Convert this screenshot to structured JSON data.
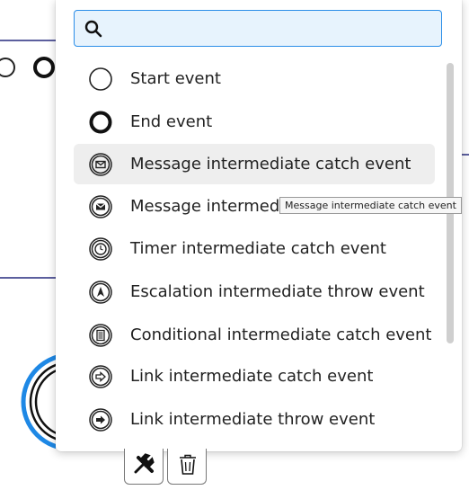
{
  "search": {
    "value": "",
    "placeholder": ""
  },
  "tooltip": "Message intermediate catch event",
  "entries": [
    {
      "label": "Start event",
      "icon": "start-event-icon"
    },
    {
      "label": "End event",
      "icon": "end-event-icon"
    },
    {
      "label": "Message intermediate catch event",
      "icon": "message-catch-icon",
      "hover": true
    },
    {
      "label": "Message intermediate throw event",
      "icon": "message-throw-icon"
    },
    {
      "label": "Timer intermediate catch event",
      "icon": "timer-catch-icon"
    },
    {
      "label": "Escalation intermediate throw event",
      "icon": "escalation-throw-icon"
    },
    {
      "label": "Conditional intermediate catch event",
      "icon": "conditional-catch-icon"
    },
    {
      "label": "Link intermediate catch event",
      "icon": "link-catch-icon"
    },
    {
      "label": "Link intermediate throw event",
      "icon": "link-throw-icon"
    }
  ],
  "toolbar": {
    "buttons": [
      "wrench-icon",
      "trash-icon"
    ]
  },
  "colors": {
    "selection": "#1e88e5",
    "search_bg": "#e7f3fd",
    "search_border": "#2b8ee8",
    "hover_bg": "#eeeeee",
    "diagram_line": "#5c5f9e"
  }
}
